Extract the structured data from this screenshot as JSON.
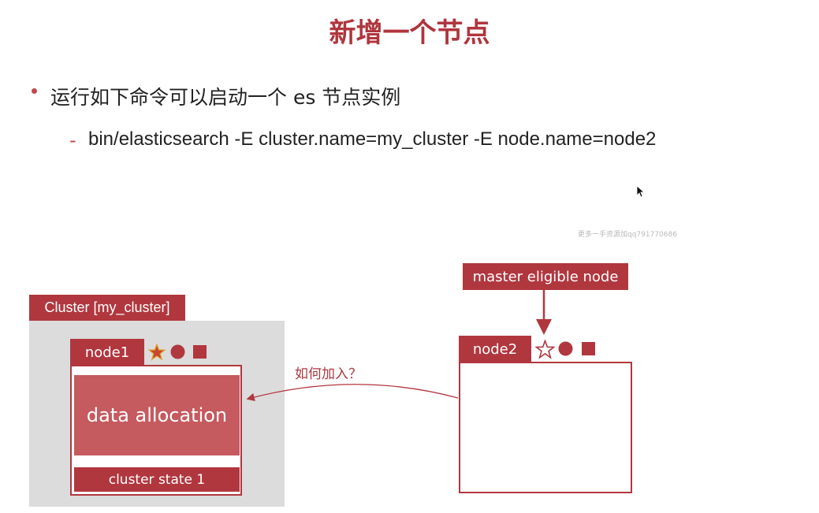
{
  "title": "新增一个节点",
  "bullet": "运行如下命令可以启动一个 es 节点实例",
  "command": "bin/elasticsearch -E cluster.name=my_cluster -E node.name=node2",
  "watermark": "更多一手资源加qq791770686",
  "cluster": {
    "label": "Cluster [my_cluster]",
    "node1": {
      "label": "node1",
      "icons": [
        "star-filled-icon",
        "circle-icon",
        "square-icon"
      ],
      "data_label": "data allocation",
      "state_label": "cluster state 1"
    }
  },
  "node2": {
    "label": "node2",
    "role_label": "master eligible node",
    "icons": [
      "star-outline-icon",
      "circle-icon",
      "square-icon"
    ]
  },
  "join_label": "如何加入？",
  "colors": {
    "accent": "#b1373f",
    "data_fill": "#c55a5f",
    "star_fill": "#c8482c",
    "star_stroke": "#e0a030"
  }
}
